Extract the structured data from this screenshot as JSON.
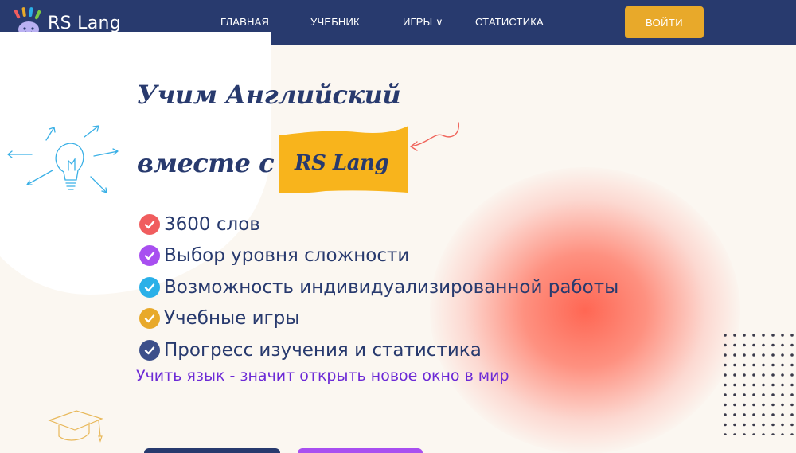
{
  "header": {
    "logo_text": "RS Lang",
    "nav": [
      {
        "label": "ГЛАВНАЯ"
      },
      {
        "label": "УЧЕБНИК"
      },
      {
        "label": "ИГРЫ ∨"
      },
      {
        "label": "СТАТИСТИКА"
      }
    ],
    "login_label": "ВОЙТИ"
  },
  "hero": {
    "title_line1": "Учим Английский",
    "title_line2": "вместе с",
    "badge": "RS Lang",
    "features": [
      {
        "text": "3600 слов",
        "color": "#f05d5e"
      },
      {
        "text": "Выбор уровня сложности",
        "color": "#a84ff0"
      },
      {
        "text": "Возможность индивидуализированной работы",
        "color": "#2ab0e8"
      },
      {
        "text": "Учебные игры",
        "color": "#e8a92a"
      },
      {
        "text": "Прогресс изучения и статистика",
        "color": "#3c4f8a"
      }
    ],
    "motto": "Учить язык - значит открыть новое окно в мир"
  },
  "colors": {
    "header_bg": "#283a6e",
    "accent_yellow": "#e8a92a",
    "badge_yellow": "#f8b41c",
    "motto_purple": "#6c2ad6"
  }
}
